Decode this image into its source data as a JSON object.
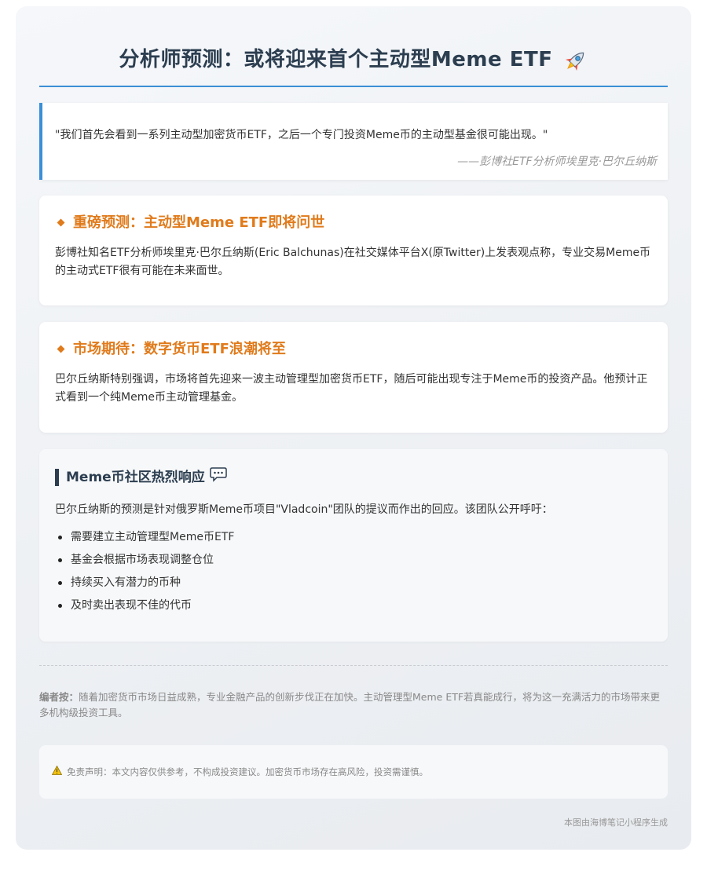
{
  "header": {
    "title": "分析师预测：或将迎来首个主动型Meme ETF",
    "title_icon": "rocket-icon"
  },
  "quote": {
    "text": "\"我们首先会看到一系列主动型加密货币ETF，之后一个专门投资Meme币的主动型基金很可能出现。\"",
    "source": "——彭博社ETF分析师埃里克·巴尔丘纳斯"
  },
  "cards": [
    {
      "title": "重磅预测：主动型Meme ETF即将问世",
      "text": "彭博社知名ETF分析师埃里克·巴尔丘纳斯(Eric Balchunas)在社交媒体平台X(原Twitter)上发表观点称，专业交易Meme币的主动式ETF很有可能在未来面世。"
    },
    {
      "title": "市场期待：数字货币ETF浪潮将至",
      "text": "巴尔丘纳斯特别强调，市场将首先迎来一波主动管理型加密货币ETF，随后可能出现专注于Meme币的投资产品。他预计正式看到一个纯Meme币主动管理基金。"
    }
  ],
  "community": {
    "title": "Meme币社区热烈响应",
    "title_icon": "chat-icon",
    "text": "巴尔丘纳斯的预测是针对俄罗斯Meme币项目\"Vladcoin\"团队的提议而作出的回应。该团队公开呼吁：",
    "items": [
      "需要建立主动管理型Meme币ETF",
      "基金会根据市场表现调整仓位",
      "持续买入有潜力的币种",
      "及时卖出表现不佳的代币"
    ]
  },
  "editor_note": {
    "label": "编者按：",
    "text": "随着加密货币市场日益成熟，专业金融产品的创新步伐正在加快。主动管理型Meme ETF若真能成行，将为这一充满活力的市场带来更多机构级投资工具。"
  },
  "disclaimer": {
    "icon": "warning-icon",
    "text": "免责声明：本文内容仅供参考，不构成投资建议。加密货币市场存在高风险，投资需谨慎。"
  },
  "footer": {
    "text": "本图由海博笔记小程序生成"
  },
  "colors": {
    "accent_blue": "#3a8fd6",
    "accent_orange": "#e07b1c",
    "heading_dark": "#2c3e50"
  }
}
